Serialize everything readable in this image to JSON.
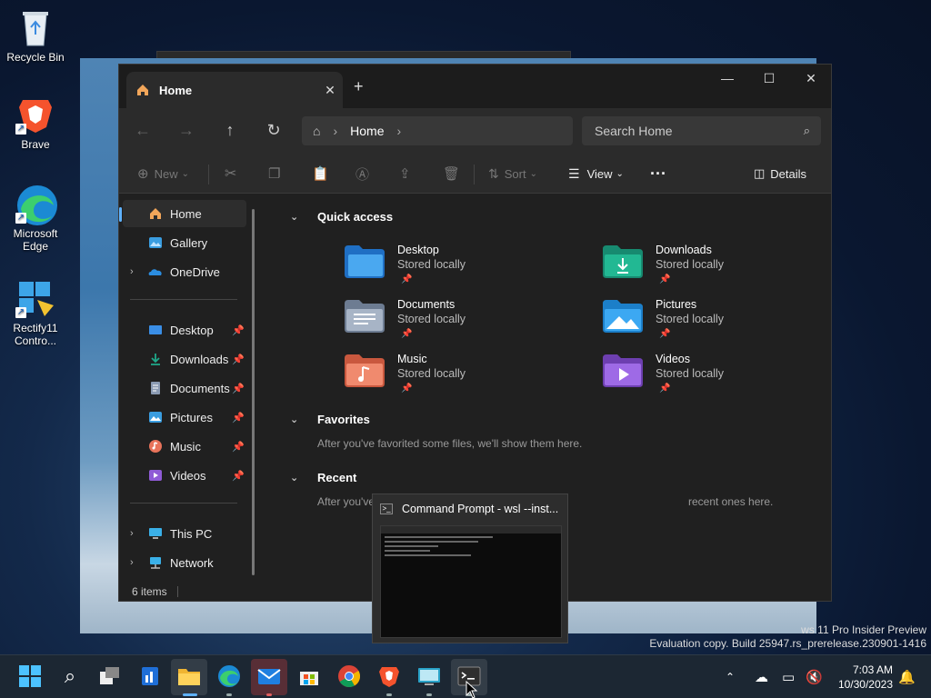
{
  "desktop": {
    "icons": [
      {
        "label": "Recycle Bin"
      },
      {
        "label": "Brave"
      },
      {
        "label": "Microsoft Edge"
      },
      {
        "label": "Rectify11 Contro..."
      }
    ]
  },
  "explorer": {
    "tab_title": "Home",
    "newtab_glyph": "+",
    "address": {
      "crumb": "Home"
    },
    "search": {
      "placeholder": "Search Home"
    },
    "toolbar": {
      "new_label": "New",
      "sort_label": "Sort",
      "view_label": "View",
      "details_label": "Details"
    },
    "sidebar": {
      "top": [
        {
          "label": "Home",
          "icon": "home-icon"
        },
        {
          "label": "Gallery",
          "icon": "gallery-icon"
        },
        {
          "label": "OneDrive",
          "icon": "onedrive-icon"
        }
      ],
      "pinned": [
        {
          "label": "Desktop",
          "icon": "desktop-folder-icon"
        },
        {
          "label": "Downloads",
          "icon": "downloads-folder-icon"
        },
        {
          "label": "Documents",
          "icon": "documents-folder-icon"
        },
        {
          "label": "Pictures",
          "icon": "pictures-folder-icon"
        },
        {
          "label": "Music",
          "icon": "music-folder-icon"
        },
        {
          "label": "Videos",
          "icon": "videos-folder-icon"
        }
      ],
      "bottom": [
        {
          "label": "This PC",
          "icon": "this-pc-icon"
        },
        {
          "label": "Network",
          "icon": "network-icon"
        }
      ]
    },
    "sections": {
      "quick_access": "Quick access",
      "favorites": "Favorites",
      "favorites_hint": "After you've favorited some files, we'll show them here.",
      "recent": "Recent",
      "recent_hint_start": "After you've",
      "recent_hint_end": "recent ones here."
    },
    "quick_access": [
      {
        "name": "Desktop",
        "sub": "Stored locally",
        "color": "#3a8ee6"
      },
      {
        "name": "Downloads",
        "sub": "Stored locally",
        "color": "#1fa98a"
      },
      {
        "name": "Documents",
        "sub": "Stored locally",
        "color": "#8b9bb3"
      },
      {
        "name": "Pictures",
        "sub": "Stored locally",
        "color": "#3a9de0"
      },
      {
        "name": "Music",
        "sub": "Stored locally",
        "color": "#e8735a"
      },
      {
        "name": "Videos",
        "sub": "Stored locally",
        "color": "#8f5bd6"
      }
    ],
    "status": "6 items"
  },
  "thumbnail": {
    "title": "Command Prompt - wsl  --inst..."
  },
  "watermark": {
    "line1": "ws 11 Pro Insider Preview",
    "line2": "Evaluation copy. Build 25947.rs_prerelease.230901-1416"
  },
  "taskbar": {
    "time": "7:03 AM",
    "date": "10/30/2023"
  }
}
